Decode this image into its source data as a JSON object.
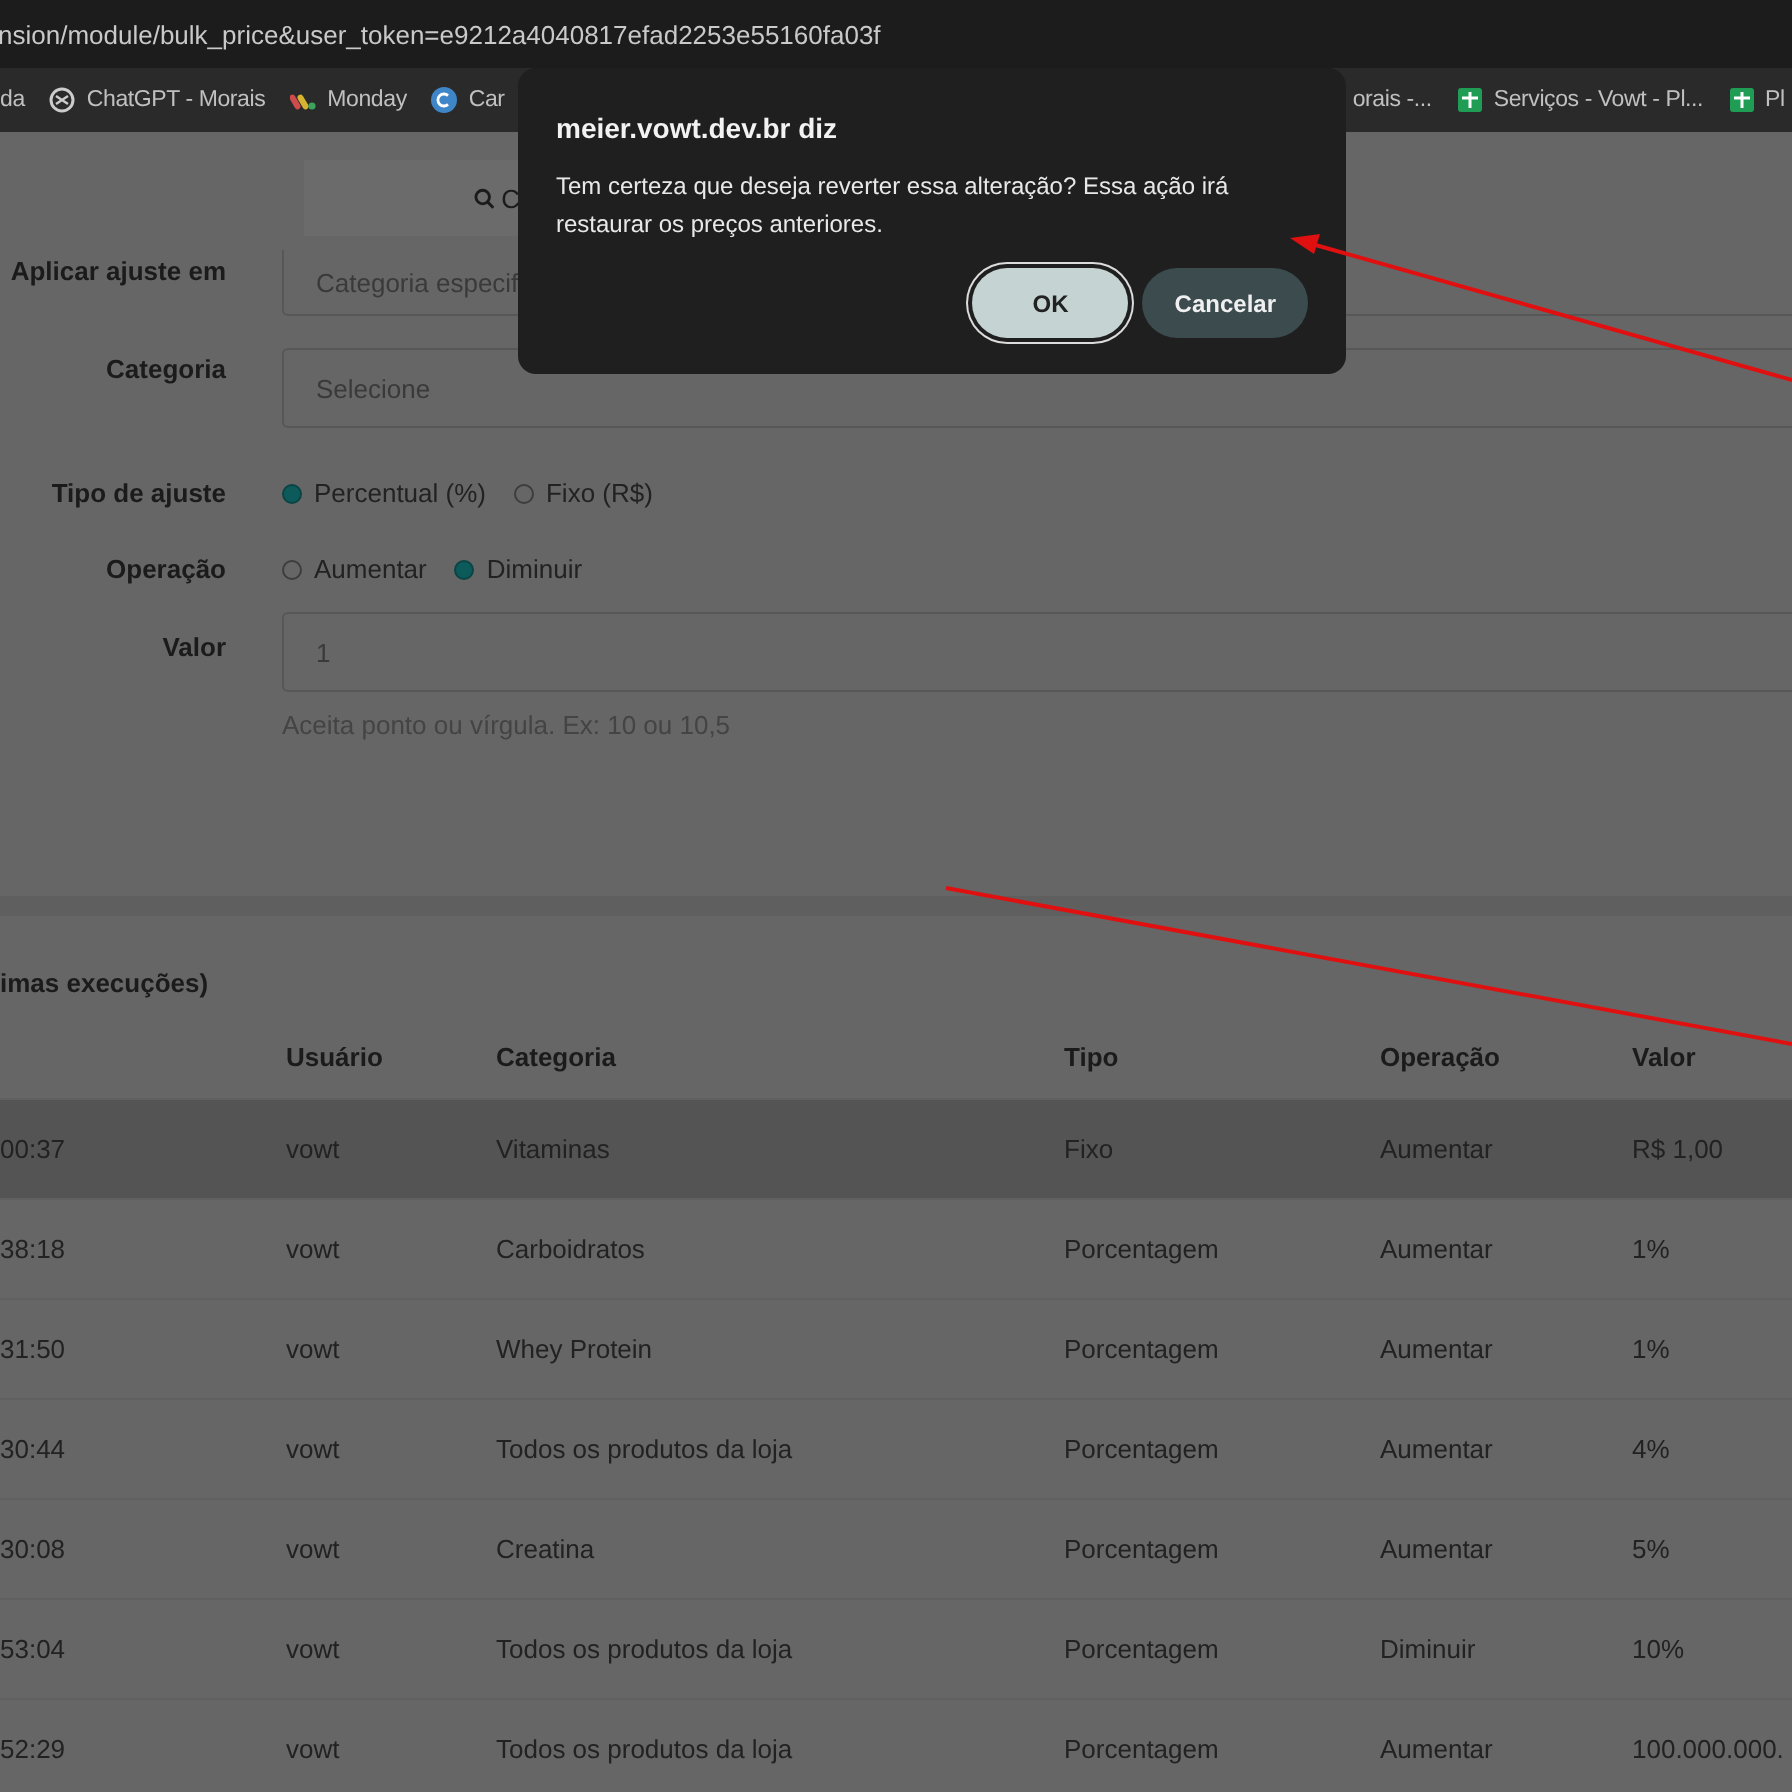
{
  "browser": {
    "url": "nsion/module/bulk_price&user_token=e9212a4040817efad2253e55160fa03f",
    "bookmarks": [
      {
        "label": "da"
      },
      {
        "label": "ChatGPT - Morais",
        "kind": "knot"
      },
      {
        "label": "Monday",
        "kind": "dots"
      },
      {
        "label": "Car",
        "kind": "circle"
      },
      {
        "label": "orais -..."
      },
      {
        "label": "Serviços - Vowt - Pl...",
        "kind": "sheet"
      },
      {
        "label": "Pl",
        "kind": "sheet"
      }
    ]
  },
  "toolbar_button": {
    "label": "C"
  },
  "form": [
    {
      "kind": "select",
      "label": "Aplicar ajuste em",
      "value": "Categoria especif"
    },
    {
      "kind": "select",
      "label": "Categoria",
      "value": "Selecione"
    },
    {
      "kind": "radio",
      "label": "Tipo de ajuste",
      "options": [
        {
          "label": "Percentual (%)",
          "selected": true
        },
        {
          "label": "Fixo (R$)",
          "selected": false
        }
      ]
    },
    {
      "kind": "radio",
      "label": "Operação",
      "options": [
        {
          "label": "Aumentar",
          "selected": false
        },
        {
          "label": "Diminuir",
          "selected": true
        }
      ]
    },
    {
      "kind": "input",
      "label": "Valor",
      "value": "1",
      "hint": "Aceita ponto ou vírgula. Ex: 10 ou 10,5"
    }
  ],
  "history": {
    "title": "imas execuções)",
    "columns": [
      "",
      "Usuário",
      "Categoria",
      "Tipo",
      "Operação",
      "Valor"
    ],
    "rows": [
      {
        "highlighted": true,
        "cells": [
          "00:37",
          "vowt",
          "Vitaminas",
          "Fixo",
          "Aumentar",
          "R$ 1,00"
        ]
      },
      {
        "highlighted": false,
        "cells": [
          "38:18",
          "vowt",
          "Carboidratos",
          "Porcentagem",
          "Aumentar",
          "1%"
        ]
      },
      {
        "highlighted": false,
        "cells": [
          "31:50",
          "vowt",
          "Whey Protein",
          "Porcentagem",
          "Aumentar",
          "1%"
        ]
      },
      {
        "highlighted": false,
        "cells": [
          "30:44",
          "vowt",
          "Todos os produtos da loja",
          "Porcentagem",
          "Aumentar",
          "4%"
        ]
      },
      {
        "highlighted": false,
        "cells": [
          "30:08",
          "vowt",
          "Creatina",
          "Porcentagem",
          "Aumentar",
          "5%"
        ]
      },
      {
        "highlighted": false,
        "cells": [
          "53:04",
          "vowt",
          "Todos os produtos da loja",
          "Porcentagem",
          "Diminuir",
          "10%"
        ]
      },
      {
        "highlighted": false,
        "cells": [
          "52:29",
          "vowt",
          "Todos os produtos da loja",
          "Porcentagem",
          "Aumentar",
          "100.000.000."
        ]
      }
    ]
  },
  "dialog": {
    "title": "meier.vowt.dev.br diz",
    "message": "Tem certeza que deseja reverter essa alteração? Essa ação irá restaurar os preços anteriores.",
    "buttons": [
      {
        "label": "OK",
        "default": true
      },
      {
        "label": "Cancelar",
        "default": false
      }
    ]
  }
}
